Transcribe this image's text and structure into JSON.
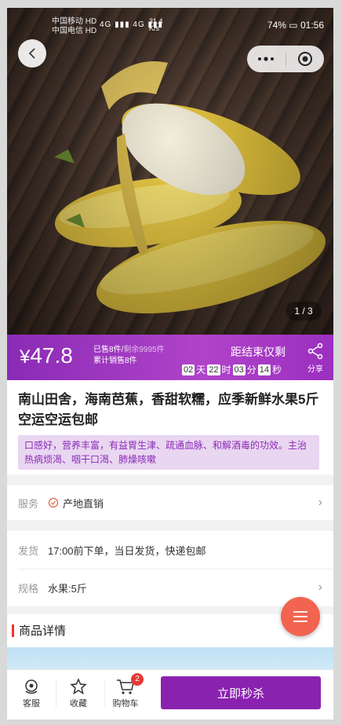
{
  "status_bar": {
    "carrier1": "中国移动 HD",
    "carrier2": "中国电信 HD",
    "signal": "4G ▮▮▮ 4G ▮▮▮",
    "speed_value": "31.4",
    "speed_unit": "K/s",
    "battery": "74%",
    "time": "01:56"
  },
  "gallery": {
    "pager": "1 / 3"
  },
  "price_bar": {
    "currency": "¥",
    "price": "47.8",
    "sold_label": "已售8件/",
    "remaining_label": "剩余9995件",
    "total_sold": "累计销售8件",
    "countdown_title": "距结束仅剩",
    "days": "02",
    "days_unit": "天",
    "hours": "22",
    "hours_unit": "时",
    "minutes": "03",
    "minutes_unit": "分",
    "seconds": "14",
    "seconds_unit": "秒",
    "share_label": "分享"
  },
  "product": {
    "title": "南山田舍，海南芭蕉，香甜软糯，应季新鲜水果5斤空运空运包邮",
    "promo": "口感好，营养丰富，有益胃生津、疏通血脉、和解酒毒的功效。主治热病烦渴、咽干口渴、肺燥咳嗽"
  },
  "service": {
    "label": "服务",
    "value": "产地直销"
  },
  "shipping": {
    "label": "发货",
    "value": "17:00前下单，当日发货，快递包邮"
  },
  "spec": {
    "label": "规格",
    "value": "水果:5斤"
  },
  "details": {
    "heading": "商品详情"
  },
  "bottom_bar": {
    "service_label": "客服",
    "favorite_label": "收藏",
    "cart_label": "购物车",
    "cart_badge": "2",
    "buy_label": "立即秒杀"
  },
  "colors": {
    "accent": "#8a22b0",
    "fab": "#f2644f",
    "badge": "#e53935"
  },
  "icons": [
    "back-arrow-icon",
    "more-dots-icon",
    "target-icon",
    "share-icon",
    "check-circle-icon",
    "chevron-right-icon",
    "menu-icon",
    "headset-icon",
    "star-icon",
    "cart-icon"
  ]
}
